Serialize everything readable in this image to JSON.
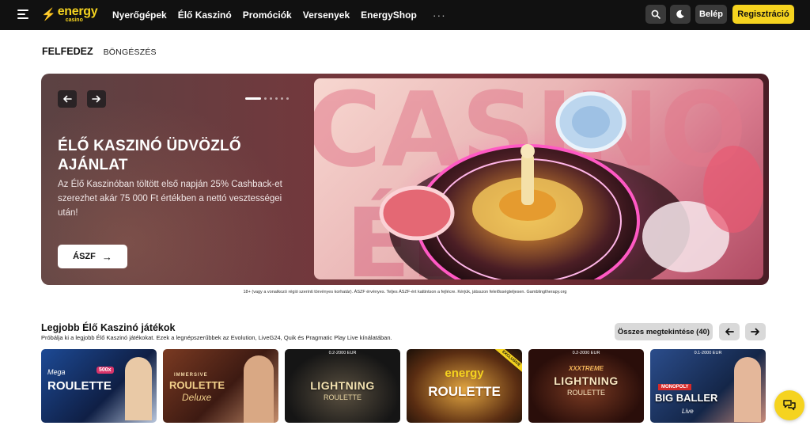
{
  "brand": {
    "logo_main": "energy",
    "logo_sub": "casino",
    "yellow": "#f5d31f",
    "dark": "#111111"
  },
  "nav": {
    "items": [
      "Nyerőgépek",
      "Élő Kaszinó",
      "Promóciók",
      "Versenyek",
      "EnergyShop"
    ],
    "more": "···",
    "login": "Belép",
    "register": "Regisztráció"
  },
  "tabs": {
    "active": "FELFEDEZ",
    "other": "BÖNGÉSZÉS"
  },
  "hero": {
    "title": "ÉLŐ KASZINÓ ÜDVÖZLŐ AJÁNLAT",
    "text": "Az Élő Kaszinóban töltött első napján 25% Cashback-et szerezhet akár 75 000 Ft értékben a nettó vesztességei után!",
    "cta": "ÁSZF",
    "image_label": "CASINO",
    "slide_count": 6,
    "active_slide": 1
  },
  "disclaimer": "18+ (vagy a vonatkozó régió szerinti törvényes korhatár). ÁSZF érvényes. Teljes ÁSZF-ért kattintson a fejlécre. Kérjük, játsszon felelősségteljesen. Gamblingtherapy.org",
  "games_section": {
    "title": "Legjobb Élő Kaszinó játékok",
    "subtitle": "Próbálja ki a legjobb Élő Kaszinó játékokat. Ezek a legnépszerűbbek az Evolution, LiveG24, Quik és Pragmatic Play Live kínálatában.",
    "view_all": "Összes megtekintése (40)",
    "games": [
      {
        "title": "ROULETTE",
        "subtitle": "Mega",
        "range": "",
        "badge": "500x",
        "bg": "#16305e"
      },
      {
        "title": "ROULETTE",
        "subtitle": "Deluxe",
        "range": "",
        "badge": "IMMERSIVE",
        "bg": "#6a3420"
      },
      {
        "title": "LIGHTNING",
        "subtitle": "ROULETTE",
        "range": "0.2-2000 EUR",
        "badge": "",
        "bg": "#1a1a1a"
      },
      {
        "title": "ROULETTE",
        "subtitle": "energy",
        "range": "",
        "badge": "EXCLUSIVE",
        "bg": "#3a2210"
      },
      {
        "title": "LIGHTNING",
        "subtitle": "ROULETTE",
        "range": "0.2-2000 EUR",
        "badge": "XXXTREME",
        "bg": "#3a1410"
      },
      {
        "title": "BIG BALLER",
        "subtitle": "MONOPOLY",
        "range": "0.1-2000 EUR",
        "badge": "Live",
        "bg": "#1c3566"
      }
    ]
  }
}
